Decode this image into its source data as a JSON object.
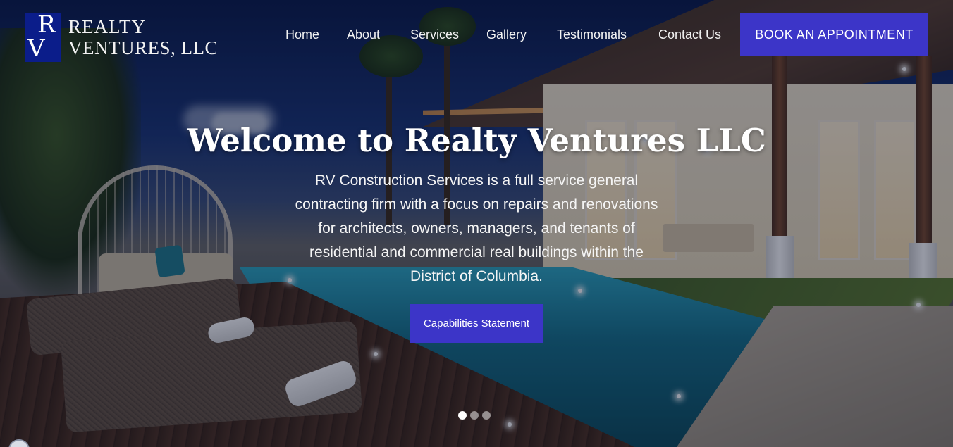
{
  "brand": {
    "logo_letter_1": "R",
    "logo_letter_2": "V",
    "name_line_1": "REALTY",
    "name_line_2": "VENTURES, LLC",
    "logo_color": "#0b1d8a"
  },
  "nav": {
    "items": [
      "Home",
      "About",
      "Services",
      "Gallery",
      "Testimonials",
      "Contact Us"
    ],
    "cta_label": "BOOK AN APPOINTMENT"
  },
  "hero": {
    "title": "Welcome to Realty Ventures LLC",
    "description_lines": [
      "RV Construction Services is a full service general",
      "contracting firm with a focus on repairs and renovations",
      "for architects, owners, managers, and tenants of",
      "residential and commercial real buildings within the",
      "District of Columbia."
    ],
    "button_label": "Capabilities Statement",
    "slides": {
      "count": 3,
      "active": 1
    }
  },
  "colors": {
    "accent": "#3c35c8",
    "text": "#ffffff"
  },
  "icons": {
    "background": "luxury-villa-pool-photo",
    "bottom_left": "chat-bubble-icon"
  }
}
